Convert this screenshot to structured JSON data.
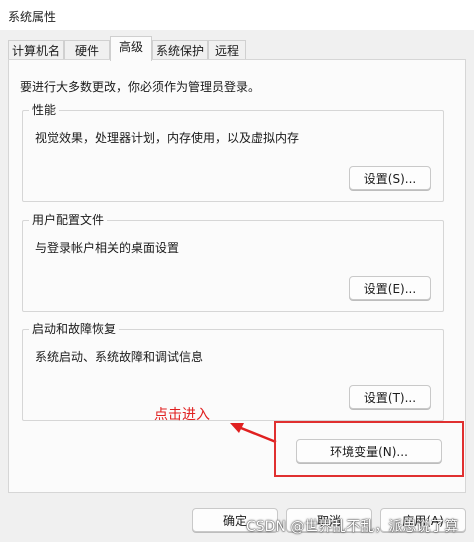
{
  "window": {
    "title": "系统属性"
  },
  "tabs": [
    {
      "label": "计算机名"
    },
    {
      "label": "硬件"
    },
    {
      "label": "高级",
      "active": true
    },
    {
      "label": "系统保护"
    },
    {
      "label": "远程"
    }
  ],
  "advanced": {
    "admin_note": "要进行大多数更改，你必须作为管理员登录。",
    "performance": {
      "title": "性能",
      "desc": "视觉效果，处理器计划，内存使用，以及虚拟内存",
      "button": "设置(S)..."
    },
    "user_profiles": {
      "title": "用户配置文件",
      "desc": "与登录帐户相关的桌面设置",
      "button": "设置(E)..."
    },
    "startup_recovery": {
      "title": "启动和故障恢复",
      "desc": "系统启动、系统故障和调试信息",
      "button": "设置(T)..."
    },
    "env_button": "环境变量(N)..."
  },
  "annotation": {
    "text": "点击进入",
    "color": "#e02020"
  },
  "footer": {
    "ok": "确定",
    "cancel": "取消",
    "apply": "应用(A)"
  },
  "watermark": "CSDN @世界乱不乱，派思说了算"
}
